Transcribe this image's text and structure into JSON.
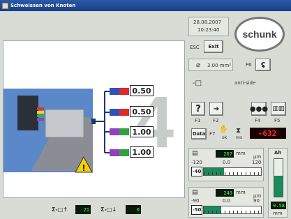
{
  "window": {
    "title": "Schweissen von Knoten"
  },
  "header": {
    "date": "28.08.2007",
    "time": "10:23:40",
    "brand": "schunk"
  },
  "controls": {
    "esc_label": "ESC",
    "exit_label": "Exit",
    "f6_label": "F6"
  },
  "cross_section": {
    "value": "3.00 mm²"
  },
  "side": {
    "value": "anti-side"
  },
  "fkeys": {
    "f1": "F1",
    "f2": "F2",
    "f4": "F4",
    "f5": "F5",
    "f7": "F7"
  },
  "data_btn": {
    "label": "Data"
  },
  "ok_label": "ok",
  "ms_label": "ms",
  "counter": {
    "value": "-632"
  },
  "gauge1": {
    "value": "267",
    "unit": "mm",
    "unit2": "µm",
    "min": "-120",
    "mid": "0.0",
    "max": "120",
    "current": "-40",
    "level": 0.35
  },
  "gauge2": {
    "value": "249",
    "unit": "mm",
    "unit2": "µm",
    "min": "-90",
    "mid": "0.0",
    "max": "90",
    "current": "-50",
    "level": 0.3
  },
  "dh": {
    "label": "Δh",
    "value": "0.58",
    "unit": "mm",
    "level": 0.55
  },
  "wires": {
    "values": [
      "0.50",
      "0.50",
      "1.00",
      "1.00"
    ],
    "big_number": "4"
  },
  "bottom": {
    "sum_in_label": "Σ-□↑",
    "sum_in_value": "21",
    "sum_out_label": "Σ-□↓",
    "sum_out_value": "0"
  }
}
